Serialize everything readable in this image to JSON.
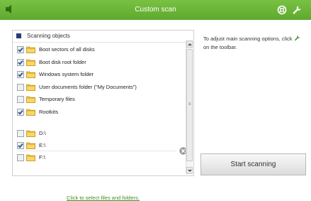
{
  "window": {
    "title": "Custom scan"
  },
  "toolbar": {
    "back_icon": "back-arrow-icon",
    "help_icon": "help-icon",
    "settings_icon": "wrench-icon"
  },
  "scan_objects": {
    "header": "Scanning objects",
    "items": [
      {
        "label": "Boot sectors of all disks",
        "checked": true
      },
      {
        "label": "Boot disk root folder",
        "checked": true
      },
      {
        "label": "Windows system folder",
        "checked": true
      },
      {
        "label": "User documents folder (\"My Documents\")",
        "checked": false
      },
      {
        "label": "Temporary files",
        "checked": false
      },
      {
        "label": "Rootkits",
        "checked": true
      }
    ],
    "drives": [
      {
        "label": "D:\\",
        "checked": false
      },
      {
        "label": "E:\\",
        "checked": true
      },
      {
        "label": "F:\\",
        "checked": false
      }
    ],
    "select_link": "Click to select files and folders."
  },
  "info": {
    "text_before": "To adjust main scanning options, click",
    "text_after": "on the toolbar."
  },
  "actions": {
    "start_label": "Start scanning"
  },
  "colors": {
    "titlebar": "#6bb83a",
    "link": "#3f8f1f",
    "folder": "#f2c94c"
  }
}
